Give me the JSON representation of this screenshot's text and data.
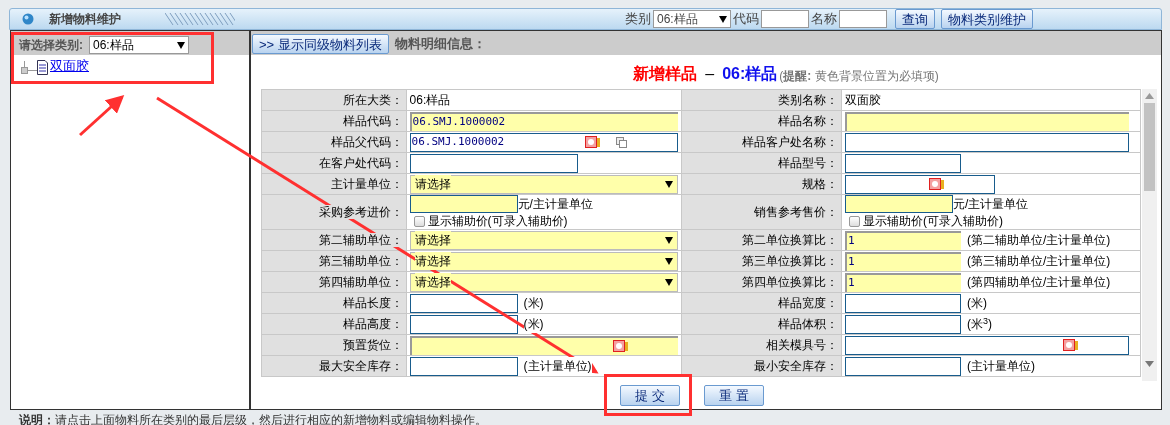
{
  "window": {
    "title": "新增物料维护"
  },
  "toolbar": {
    "category_label": "类别",
    "category_value": "06:样品",
    "code_label": "代码",
    "name_label": "名称",
    "buttons": [
      "查询",
      "物料类别维护"
    ]
  },
  "sidebar": {
    "label": "请选择类别:",
    "category_value": "06:样品",
    "tree": [
      {
        "label": "双面胶",
        "selected": false
      }
    ]
  },
  "detail": {
    "toggle_button": ">> 显示同级物料列表",
    "section_title": "物料明细信息：",
    "heading": {
      "action": "新增样品",
      "separator": "–",
      "category": "06:样品",
      "note": "(**提醒:** 黄色背景位置为必填项)"
    },
    "rows": [
      [
        {
          "label": "所在大类：",
          "kind": "text",
          "value": "06:样品"
        },
        {
          "label": "类别名称：",
          "kind": "text",
          "value": "双面胶"
        }
      ],
      [
        {
          "label": "样品代码：",
          "kind": "long_input",
          "required": true,
          "value": "06.SMJ.1000002"
        },
        {
          "label": "样品名称：",
          "kind": "long_input",
          "required": true
        }
      ],
      [
        {
          "label": "样品父代码：",
          "kind": "long_input",
          "required": false,
          "value": "06.SMJ.1000002",
          "picker": true,
          "copy": true
        },
        {
          "label": "样品客户处名称：",
          "kind": "long_input",
          "required": false
        }
      ],
      [
        {
          "label": "在客户处代码：",
          "kind": "medium_input",
          "required": false
        },
        {
          "label": "样品型号：",
          "kind": "short_input",
          "required": false
        }
      ],
      [
        {
          "label": "主计量单位：",
          "kind": "select",
          "required": true,
          "value": "请选择"
        },
        {
          "label": "规格：",
          "kind": "medium_input",
          "required": false,
          "picker": true
        }
      ],
      [
        {
          "label": "采购参考进价：",
          "kind": "price",
          "required": true,
          "suffix": "元/主计量单位",
          "checkbox": {
            "label": "显示辅助价(可录入辅助价)",
            "checked": false
          }
        },
        {
          "label": "销售参考售价：",
          "kind": "price",
          "required": true,
          "suffix": "元/主计量单位",
          "checkbox": {
            "label": "显示辅助价(可录入辅助价)",
            "checked": false
          }
        }
      ],
      [
        {
          "label": "第二辅助单位：",
          "kind": "select",
          "required": true,
          "value": "请选择"
        },
        {
          "label": "第二单位换算比：",
          "kind": "short_input",
          "required": true,
          "value": "1",
          "suffix": "(第二辅助单位/主计量单位)"
        }
      ],
      [
        {
          "label": "第三辅助单位：",
          "kind": "select",
          "required": true,
          "value": "请选择"
        },
        {
          "label": "第三单位换算比：",
          "kind": "short_input",
          "required": true,
          "value": "1",
          "suffix": "(第三辅助单位/主计量单位)"
        }
      ],
      [
        {
          "label": "第四辅助单位：",
          "kind": "select",
          "required": true,
          "value": "请选择"
        },
        {
          "label": "第四单位换算比：",
          "kind": "short_input",
          "required": true,
          "value": "1",
          "suffix": "(第四辅助单位/主计量单位)"
        }
      ],
      [
        {
          "label": "样品长度：",
          "kind": "short_input",
          "required": false,
          "suffix": "(米)"
        },
        {
          "label": "样品宽度：",
          "kind": "short_input",
          "required": false,
          "suffix": "(米)"
        }
      ],
      [
        {
          "label": "样品高度：",
          "kind": "short_input",
          "required": false,
          "suffix": "(米)"
        },
        {
          "label": "样品体积：",
          "kind": "short_input",
          "required": false,
          "suffix": "(米$^{3}$)"
        }
      ],
      [
        {
          "label": "预置货位：",
          "kind": "long_input",
          "required": true,
          "picker": true
        },
        {
          "label": "相关模具号：",
          "kind": "long_input",
          "required": false,
          "picker": true
        }
      ],
      [
        {
          "label": "最大安全库存：",
          "kind": "short_input",
          "required": false,
          "suffix": "(主计量单位)"
        },
        {
          "label": "最小安全库存：",
          "kind": "short_input",
          "required": false,
          "suffix": "(主计量单位)"
        }
      ]
    ],
    "buttons": [
      "提 交",
      "重 置"
    ]
  },
  "status_bar": "**说明：**请点击上面物料所在类别的最后层级，然后进行相应的新增物料或编辑物料操作。"
}
